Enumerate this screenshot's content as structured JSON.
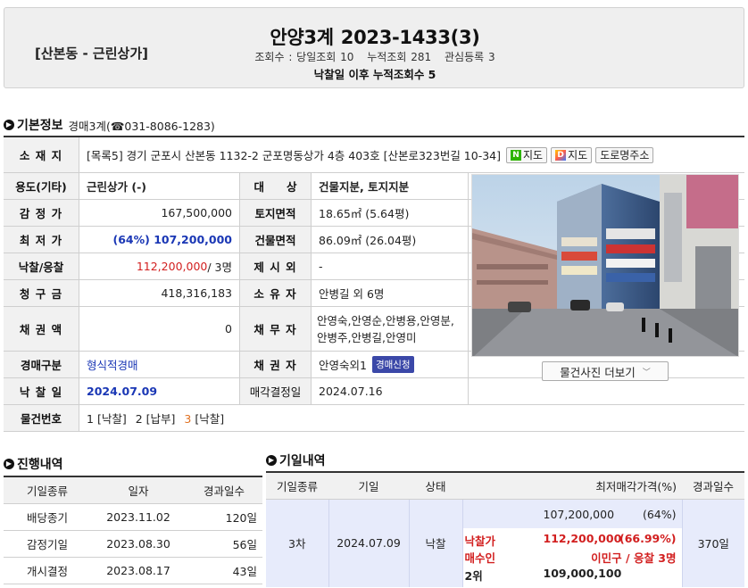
{
  "header": {
    "location": "[산본동 - 근린상가]",
    "title": "안양3계",
    "case_no": "2023-1433(3)",
    "views_label": "조회수 : 당일조회 10",
    "cum_views": "누적조회 281",
    "interest": "관심등록 3",
    "after_bid": "낙찰일 이후 누적조회수 5"
  },
  "basic": {
    "title": "기본정보",
    "dept": "경매3계(☎031-8086-1283)",
    "address_label": "소 재 지",
    "address": "[목록5] 경기 군포시 산본동 1132-2 군포명동상가 4층 403호 [산본로323번길 10-34]",
    "naver_map": "지도",
    "daum_map": "지도",
    "road_address": "도로명주소",
    "usage_label": "용도(기타)",
    "usage": "근린상가 (-)",
    "target_label": "대　　상",
    "target": "건물지분, 토지지분",
    "appraisal_label": "감 정 가",
    "appraisal": "167,500,000",
    "land_area_label": "토지면적",
    "land_area": "18.65㎡ (5.64평)",
    "min_price_label": "최 저 가",
    "min_price": "(64%) 107,200,000",
    "bldg_area_label": "건물면적",
    "bldg_area": "86.09㎡ (26.04평)",
    "winning_label": "낙찰/응찰",
    "winning_price": "112,200,000",
    "bidders": " / 3명",
    "excluded_label": "제 시 외",
    "excluded": "-",
    "claim_label": "청 구 금",
    "claim": "418,316,183",
    "owner_label": "소 유 자",
    "owner": "안병길 외 6명",
    "credit_label": "채 권 액",
    "credit": "0",
    "debtor_label": "채 무 자",
    "debtor": "안영숙,안영순,안병용,안영분,안병주,안병길,안영미",
    "auction_type_label": "경매구분",
    "auction_type": "형식적경매",
    "creditor_label": "채 권 자",
    "creditor": "안영숙외1",
    "auction_apply": "경매신청",
    "bid_date_label": "낙 찰 일",
    "bid_date": "2024.07.09",
    "decision_label": "매각결정일",
    "decision_date": "2024.07.16",
    "item_label": "물건번호",
    "item_1": "1",
    "item_1_status": "[낙찰]",
    "item_2": "2",
    "item_2_status": "[납부]",
    "item_3": "3",
    "item_3_status": "[낙찰]",
    "more_photos": "물건사진 더보기"
  },
  "progress": {
    "title": "진행내역",
    "headers": [
      "기일종류",
      "일자",
      "경과일수"
    ],
    "rows": [
      {
        "type": "배당종기",
        "date": "2023.11.02",
        "days": "120일"
      },
      {
        "type": "감정기일",
        "date": "2023.08.30",
        "days": "56일"
      },
      {
        "type": "개시결정",
        "date": "2023.08.17",
        "days": "43일"
      }
    ]
  },
  "dates": {
    "title": "기일내역",
    "headers": [
      "기일종류",
      "기일",
      "상태",
      "최저매각가격(%)",
      "경과일수"
    ],
    "row": {
      "kind": "3차",
      "date": "2024.07.09",
      "status": "낙찰",
      "min_price": "107,200,000",
      "min_pct": "(64%)",
      "won_label": "낙찰가",
      "won_price": "112,200,000",
      "won_pct": "(66.99%)",
      "buyer_label": "매수인",
      "buyer": "이민구 / 응찰 3명",
      "second_label": "2위",
      "second_price": "109,000,100",
      "days": "370일"
    }
  }
}
